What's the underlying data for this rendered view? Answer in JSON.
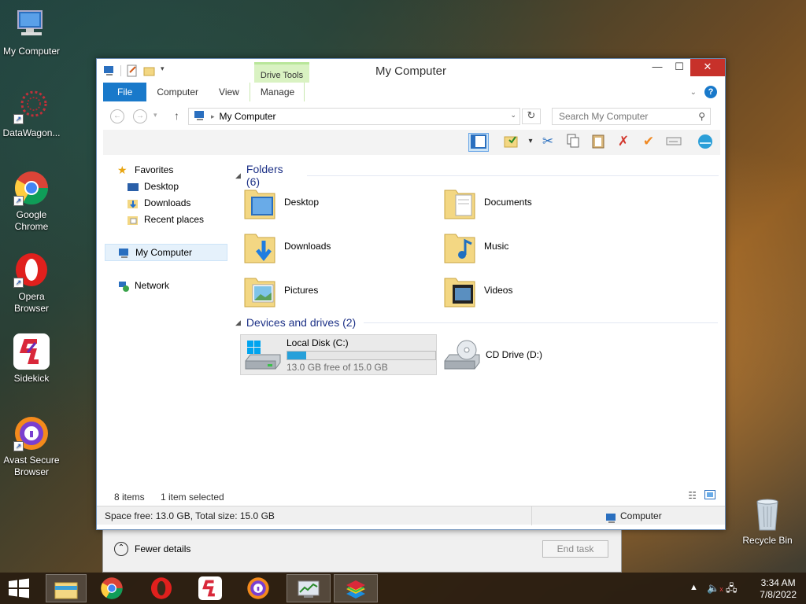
{
  "desktop": {
    "icons": [
      {
        "label": "My Computer",
        "icon": "computer-icon"
      },
      {
        "label": "DataWagon...",
        "icon": "datawagon-icon"
      },
      {
        "label": "Google Chrome",
        "icon": "chrome-icon"
      },
      {
        "label": "Opera Browser",
        "icon": "opera-icon"
      },
      {
        "label": "Sidekick",
        "icon": "sidekick-icon"
      },
      {
        "label": "Avast Secure Browser",
        "icon": "avast-icon"
      },
      {
        "label": "Recycle Bin",
        "icon": "recycle-bin-icon"
      }
    ]
  },
  "window": {
    "title": "My Computer",
    "contextual_tab": "Drive Tools",
    "tabs": [
      "File",
      "Computer",
      "View",
      "Manage"
    ],
    "address": "My Computer",
    "search_placeholder": "Search My Computer"
  },
  "nav_pane": {
    "favorites": "Favorites",
    "items": [
      "Desktop",
      "Downloads",
      "Recent places"
    ],
    "my_computer": "My Computer",
    "network": "Network"
  },
  "content": {
    "folders_header": "Folders (6)",
    "folders": [
      "Desktop",
      "Documents",
      "Downloads",
      "Music",
      "Pictures",
      "Videos"
    ],
    "devices_header": "Devices and drives (2)",
    "drives": [
      {
        "name": "Local Disk (C:)",
        "free_text": "13.0 GB free of 15.0 GB",
        "used_fraction": 0.13
      },
      {
        "name": "CD Drive (D:)"
      }
    ]
  },
  "status": {
    "items_count": "8 items",
    "selected": "1 item selected",
    "space": "Space free: 13.0 GB, Total size: 15.0 GB",
    "location": "Computer"
  },
  "task_dialog": {
    "fewer_details": "Fewer details",
    "end_task": "End task"
  },
  "tray": {
    "time": "3:34 AM",
    "date": "7/8/2022"
  },
  "colors": {
    "accent": "#1979ca",
    "close": "#c7312a",
    "drive_bar": "#26a0da"
  }
}
